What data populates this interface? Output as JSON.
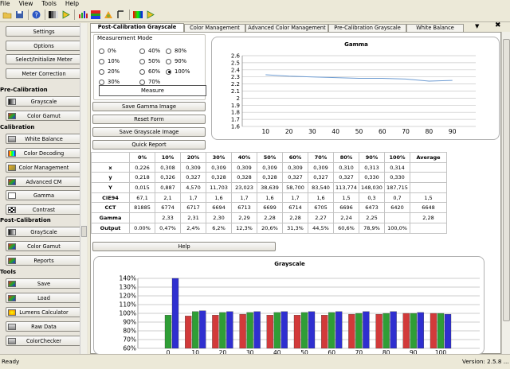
{
  "menu": [
    "File",
    "View",
    "Tools",
    "Help"
  ],
  "toolbar_icons": [
    "open-folder-icon",
    "save-disk-icon",
    "help-icon",
    "grayscale-icon",
    "play-icon",
    "chart-icon",
    "color-gamut-icon",
    "color-management-icon",
    "gamma-icon",
    "decoding-icon",
    "play-green-icon"
  ],
  "sidebar": {
    "buttons_top": [
      {
        "label": "Settings",
        "name": "settings-button"
      },
      {
        "label": "Options",
        "name": "options-button"
      },
      {
        "label": "Select/Initialize Meter",
        "name": "select-meter-button"
      },
      {
        "label": "Meter Correction",
        "name": "meter-correction-button"
      }
    ],
    "heading_pre": "Pre-Calibration",
    "pre": [
      {
        "label": "Grayscale",
        "icon": "grayscale-icon"
      },
      {
        "label": "Color Gamut",
        "icon": "color-gamut-icon"
      }
    ],
    "heading_cal": "Calibration",
    "cal": [
      {
        "label": "White Balance",
        "icon": "white-balance-icon"
      },
      {
        "label": "Color Decoding",
        "icon": "color-decoding-icon"
      },
      {
        "label": "Color Management",
        "icon": "color-management-icon"
      },
      {
        "label": "Advanced CM",
        "icon": "advanced-cm-icon"
      },
      {
        "label": "Gamma",
        "icon": "gamma-icon"
      },
      {
        "label": "Contrast",
        "icon": "contrast-icon"
      }
    ],
    "heading_post": "Post-Calibration",
    "post": [
      {
        "label": "GrayScale",
        "icon": "grayscale-icon"
      },
      {
        "label": "Color Gamut",
        "icon": "color-gamut-icon"
      },
      {
        "label": "Reports",
        "icon": "reports-icon"
      }
    ],
    "heading_tools": "Tools",
    "tools": [
      {
        "label": "Save",
        "icon": "save-icon"
      },
      {
        "label": "Load",
        "icon": "load-icon"
      },
      {
        "label": "Lumens Calculator",
        "icon": "lumens-calculator-icon"
      },
      {
        "label": "Raw Data",
        "icon": "raw-data-icon"
      },
      {
        "label": "ColorChecker",
        "icon": "colorchecker-icon"
      }
    ]
  },
  "tabs": [
    "Post-Calibration Grayscale",
    "Color Management",
    "Advanced Color Management",
    "Pre-Calibration Grayscale",
    "White Balance"
  ],
  "tab_controls": {
    "arrow": "▼",
    "close": "✖"
  },
  "measurement": {
    "title": "Measurement Mode",
    "options": [
      "0%",
      "10%",
      "20%",
      "30%",
      "40%",
      "50%",
      "60%",
      "70%",
      "80%",
      "90%",
      "100%"
    ],
    "selected": "100%",
    "measure_label": "Measure"
  },
  "actions": [
    "Save Gamma Image",
    "Reset Form",
    "Save Grayscale Image",
    "Quick Report"
  ],
  "help_label": "Help",
  "table": {
    "headers": [
      "",
      "0%",
      "10%",
      "20%",
      "30%",
      "40%",
      "50%",
      "60%",
      "70%",
      "80%",
      "90%",
      "100%",
      "Average"
    ],
    "rows": [
      [
        "x",
        "0,226",
        "0,308",
        "0,309",
        "0,309",
        "0,309",
        "0,309",
        "0,309",
        "0,309",
        "0,310",
        "0,313",
        "0,314",
        ""
      ],
      [
        "y",
        "0,218",
        "0,326",
        "0,327",
        "0,328",
        "0,328",
        "0,328",
        "0,327",
        "0,327",
        "0,327",
        "0,330",
        "0,330",
        ""
      ],
      [
        "Y",
        "0,015",
        "0,887",
        "4,570",
        "11,703",
        "23,023",
        "38,639",
        "58,700",
        "83,540",
        "113,774",
        "148,030",
        "187,715",
        ""
      ],
      [
        "CIE94",
        "67,1",
        "2,1",
        "1,7",
        "1,6",
        "1,7",
        "1,6",
        "1,7",
        "1,6",
        "1,5",
        "0,3",
        "0,7",
        "1,5"
      ],
      [
        "CCT",
        "81885",
        "6774",
        "6717",
        "6694",
        "6713",
        "6699",
        "6714",
        "6705",
        "6696",
        "6473",
        "6420",
        "6648"
      ],
      [
        "Gamma",
        "",
        "2,33",
        "2,31",
        "2,30",
        "2,29",
        "2,28",
        "2,28",
        "2,27",
        "2,24",
        "2,25",
        "",
        "2,28"
      ],
      [
        "Output",
        "0.00%",
        "0,47%",
        "2,4%",
        "6,2%",
        "12,3%",
        "20,6%",
        "31,3%",
        "44,5%",
        "60,6%",
        "78,9%",
        "100,0%",
        ""
      ]
    ]
  },
  "gamma_chart": {
    "title": "Gamma",
    "x_ticks": [
      "10",
      "20",
      "30",
      "40",
      "50",
      "60",
      "70",
      "80",
      "90"
    ],
    "y_ticks": [
      "2.6",
      "2.5",
      "2.4",
      "2.3",
      "2.2",
      "2.1",
      "2",
      "1.9",
      "1.8",
      "1.7",
      "1.6"
    ],
    "line_color": "#6e9cd2"
  },
  "chart_data": [
    {
      "type": "line",
      "title": "Gamma",
      "x": [
        10,
        20,
        30,
        40,
        50,
        60,
        70,
        80,
        90
      ],
      "series": [
        {
          "values": [
            2.33,
            2.31,
            2.3,
            2.29,
            2.28,
            2.28,
            2.27,
            2.24,
            2.25
          ]
        }
      ],
      "xlim": [
        0,
        100
      ],
      "ylim": [
        1.6,
        2.6
      ],
      "grid": true
    },
    {
      "type": "bar",
      "title": "Grayscale",
      "categories": [
        "0",
        "10",
        "20",
        "30",
        "40",
        "50",
        "60",
        "70",
        "80",
        "90",
        "100"
      ],
      "y_ticks": [
        "140%",
        "130%",
        "120%",
        "110%",
        "100%",
        "90%",
        "80%",
        "70%",
        "60%"
      ],
      "ylim": [
        60,
        140
      ],
      "grid": true,
      "colors": [
        "#d23a3a",
        "#2f9e36",
        "#2f2fd0"
      ],
      "series": [
        {
          "values": [
            0,
            97,
            98,
            99,
            98,
            98,
            98,
            99,
            99,
            100,
            100
          ]
        },
        {
          "values": [
            98,
            102,
            101,
            101,
            101,
            101,
            101,
            100,
            100,
            100,
            100
          ]
        },
        {
          "values": [
            140,
            103,
            102,
            102,
            102,
            102,
            102,
            102,
            102,
            101,
            99
          ]
        }
      ]
    }
  ],
  "status": {
    "left": "Ready",
    "right": "Version: 2.5.8 ..."
  }
}
